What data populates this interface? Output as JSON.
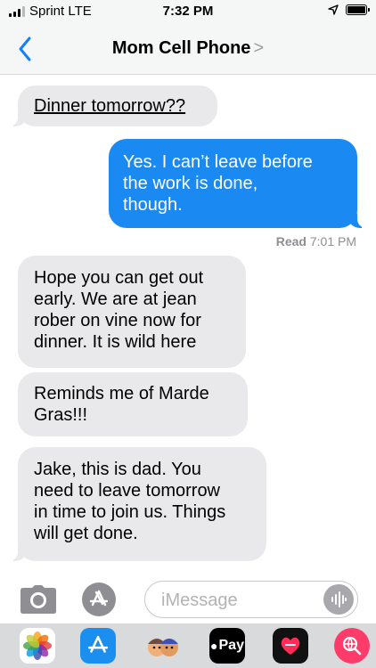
{
  "status": {
    "carrier": "Sprint LTE",
    "time": "7:32 PM"
  },
  "nav": {
    "title": "Mom Cell Phone",
    "chevron": ">"
  },
  "messages": [
    {
      "direction": "incoming",
      "text": "Dinner tomorrow??"
    },
    {
      "direction": "outgoing",
      "text": "Yes.  I can’t leave before\nthe work is done,\nthough."
    },
    {
      "direction": "incoming",
      "text": "Hope you can get out\nearly. We are at jean\nrober on vine now for\ndinner. It is wild here"
    },
    {
      "direction": "incoming",
      "text": "Reminds me of Marde\nGras!!!"
    },
    {
      "direction": "incoming",
      "text": "Jake, this is dad. You\nneed to leave tomorrow\nin time to join us. Things\nwill get done."
    }
  ],
  "read_receipt": {
    "label": "Read",
    "time": "7:01 PM"
  },
  "input": {
    "placeholder": "iMessage",
    "value": ""
  },
  "app_drawer": {
    "apple_pay_label": "Pay",
    "apps": [
      "photos-icon",
      "app-store-icon",
      "memoji-icon",
      "apple-pay-icon",
      "digital-touch-icon",
      "web-search-icon"
    ]
  },
  "colors": {
    "outgoing_bubble": "#1a89f2",
    "incoming_bubble": "#e9e9eb",
    "accent": "#147efb"
  }
}
